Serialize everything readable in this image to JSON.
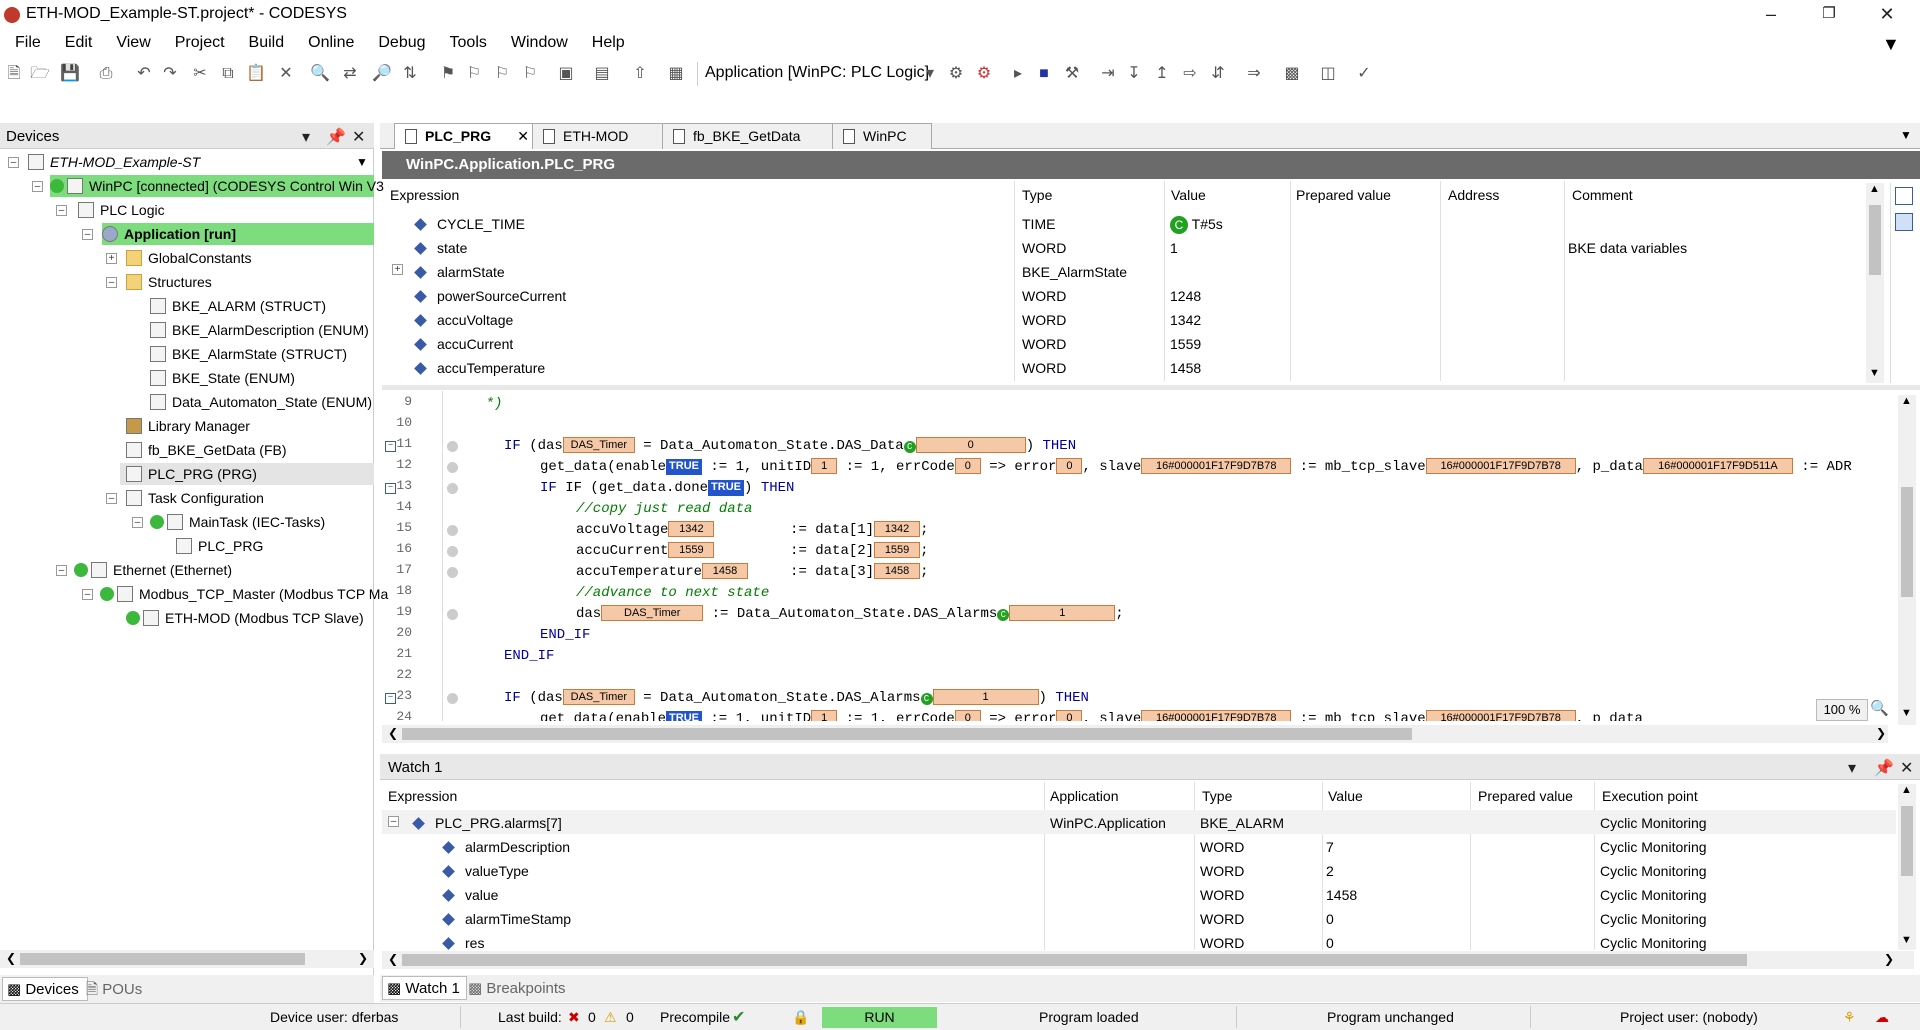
{
  "window": {
    "title": "ETH-MOD_Example-ST.project* - CODESYS"
  },
  "menu": [
    "File",
    "Edit",
    "View",
    "Project",
    "Build",
    "Online",
    "Debug",
    "Tools",
    "Window",
    "Help"
  ],
  "toolbar": {
    "application_selector": "Application [WinPC: PLC Logic]"
  },
  "devices": {
    "title": "Devices",
    "tree": [
      {
        "label": "ETH-MOD_Example-ST",
        "italic": true
      },
      {
        "label": "WinPC [connected] (CODESYS Control Win V3"
      },
      {
        "label": "PLC Logic"
      },
      {
        "label": "Application [run]"
      },
      {
        "label": "GlobalConstants"
      },
      {
        "label": "Structures"
      },
      {
        "label": "BKE_ALARM (STRUCT)"
      },
      {
        "label": "BKE_AlarmDescription (ENUM)"
      },
      {
        "label": "BKE_AlarmState (STRUCT)"
      },
      {
        "label": "BKE_State (ENUM)"
      },
      {
        "label": "Data_Automaton_State (ENUM)"
      },
      {
        "label": "Library Manager"
      },
      {
        "label": "fb_BKE_GetData (FB)"
      },
      {
        "label": "PLC_PRG (PRG)"
      },
      {
        "label": "Task Configuration"
      },
      {
        "label": "MainTask (IEC-Tasks)"
      },
      {
        "label": "PLC_PRG"
      },
      {
        "label": "Ethernet (Ethernet)"
      },
      {
        "label": "Modbus_TCP_Master (Modbus TCP Ma"
      },
      {
        "label": "ETH-MOD (Modbus TCP Slave)"
      }
    ],
    "bottom_tabs": [
      "Devices",
      "POUs"
    ]
  },
  "editor": {
    "tabs": [
      "PLC_PRG",
      "ETH-MOD",
      "fb_BKE_GetData",
      "WinPC"
    ],
    "path": "WinPC.Application.PLC_PRG",
    "columns": [
      "Expression",
      "Type",
      "Value",
      "Prepared value",
      "Address",
      "Comment"
    ],
    "rows": [
      {
        "expr": "CYCLE_TIME",
        "type": "TIME",
        "value": "T#5s",
        "comment": ""
      },
      {
        "expr": "state",
        "type": "WORD",
        "value": "1",
        "comment": "BKE data variables"
      },
      {
        "expr": "alarmState",
        "type": "BKE_AlarmState",
        "value": "",
        "comment": ""
      },
      {
        "expr": "powerSourceCurrent",
        "type": "WORD",
        "value": "1248",
        "comment": ""
      },
      {
        "expr": "accuVoltage",
        "type": "WORD",
        "value": "1342",
        "comment": ""
      },
      {
        "expr": "accuCurrent",
        "type": "WORD",
        "value": "1559",
        "comment": ""
      },
      {
        "expr": "accuTemperature",
        "type": "WORD",
        "value": "1458",
        "comment": ""
      }
    ],
    "line_numbers": [
      "9",
      "10",
      "11",
      "12",
      "13",
      "14",
      "15",
      "16",
      "17",
      "18",
      "19",
      "20",
      "21",
      "22",
      "23",
      "24"
    ],
    "zoom": "100 %",
    "code": {
      "l9": "    *)",
      "if": "IF",
      "then": "THEN",
      "das": "das",
      "das_timer": "DAS_Timer",
      "eq_das_data": " = Data_Automaton_State.DAS_Data",
      "eq_das_alarms": " = Data_Automaton_State.DAS_Alarms",
      "assign_das_alarms": " := Data_Automaton_State.DAS_Alarms",
      "v0": "0",
      "v1": "1",
      "true": "TRUE",
      "get_data_enable": "get_data(enable",
      "unitid_seg": " := 1, unitID",
      "errcode_seg": " := 1, errCode",
      "error_seg": " => error",
      "slave_seg": ", slave",
      "mbtcp_seg": " := mb_tcp_slave",
      "pdata_seg": ", p_data",
      "adr_seg": " := ADR",
      "addr1": "16#000001F17F9D7B78",
      "addr2": "16#000001F17F9D511A",
      "if_get_done": "IF (get_data.done",
      "comment_copy": "//copy just read data",
      "accuVoltage": "accuVoltage",
      "accuCurrent": "accuCurrent",
      "accuTemperature": "accuTemperature",
      "val_volt": "1342",
      "val_curr": "1559",
      "val_temp": "1458",
      "data1": ":= data[1]",
      "data2": ":= data[2]",
      "data3": ":= data[3]",
      "comment_next": "//advance to next state",
      "end_if": "END_IF"
    }
  },
  "watch": {
    "title": "Watch 1",
    "columns": [
      "Expression",
      "Application",
      "Type",
      "Value",
      "Prepared value",
      "Execution point"
    ],
    "rows": [
      {
        "expr": "PLC_PRG.alarms[7]",
        "app": "WinPC.Application",
        "type": "BKE_ALARM",
        "value": "",
        "exec": "Cyclic Monitoring"
      },
      {
        "expr": "alarmDescription",
        "app": "",
        "type": "WORD",
        "value": "7",
        "exec": "Cyclic Monitoring"
      },
      {
        "expr": "valueType",
        "app": "",
        "type": "WORD",
        "value": "2",
        "exec": "Cyclic Monitoring"
      },
      {
        "expr": "value",
        "app": "",
        "type": "WORD",
        "value": "1458",
        "exec": "Cyclic Monitoring"
      },
      {
        "expr": "alarmTimeStamp",
        "app": "",
        "type": "WORD",
        "value": "0",
        "exec": "Cyclic Monitoring"
      },
      {
        "expr": "res",
        "app": "",
        "type": "WORD",
        "value": "0",
        "exec": "Cyclic Monitoring"
      }
    ],
    "bottom_tabs": [
      "Watch 1",
      "Breakpoints"
    ]
  },
  "status": {
    "device_user": "Device user: dferbas",
    "last_build": "Last build:",
    "errors": "0",
    "warnings": "0",
    "precompile": "Precompile",
    "run": "RUN",
    "program_loaded": "Program loaded",
    "program_unchanged": "Program unchanged",
    "project_user": "Project user: (nobody)"
  },
  "colors": {
    "green_highlight": "#7ddc7d",
    "path_bar": "#6b6b6b",
    "run": "#7ddc7d",
    "inline_value": "#f5c9a8",
    "true_bg": "#2255cc"
  }
}
